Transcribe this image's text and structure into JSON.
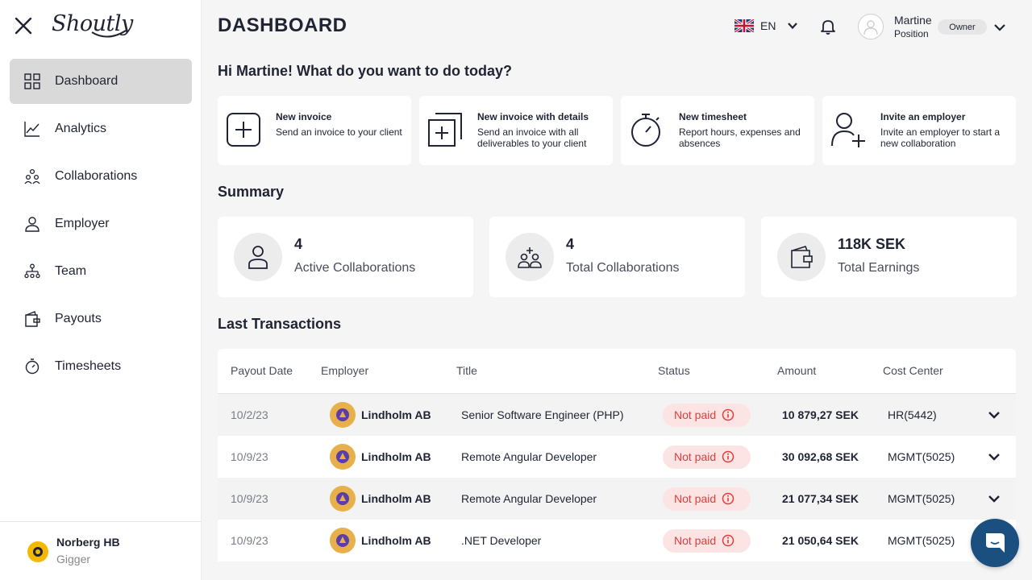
{
  "brand": {
    "logo_text": "Shoutly"
  },
  "sidebar": {
    "items": [
      {
        "label": "Dashboard",
        "icon": "grid-icon",
        "active": true
      },
      {
        "label": "Analytics",
        "icon": "chart-line-icon",
        "active": false
      },
      {
        "label": "Collaborations",
        "icon": "collaborations-icon",
        "active": false
      },
      {
        "label": "Employer",
        "icon": "employer-icon",
        "active": false
      },
      {
        "label": "Team",
        "icon": "team-icon",
        "active": false
      },
      {
        "label": "Payouts",
        "icon": "wallet-icon",
        "active": false
      },
      {
        "label": "Timesheets",
        "icon": "stopwatch-icon",
        "active": false
      }
    ],
    "footer": {
      "company_name": "Norberg HB",
      "company_role": "Gigger"
    }
  },
  "header": {
    "title": "DASHBOARD",
    "language": "EN",
    "user": {
      "name": "Martine",
      "position": "Position",
      "role": "Owner"
    }
  },
  "greeting": "Hi Martine! What do you want to do today?",
  "quick_actions": [
    {
      "title": "New invoice",
      "description": "Send an invoice to your client",
      "icon": "plus-square-icon"
    },
    {
      "title": "New invoice with details",
      "description": "Send an invoice with all deliverables to your client",
      "icon": "plus-document-icon"
    },
    {
      "title": "New timesheet",
      "description": "Report hours, expenses and absences",
      "icon": "stopwatch-icon"
    },
    {
      "title": "Invite an employer",
      "description": "Invite an employer to start a new collaboration",
      "icon": "user-plus-icon"
    }
  ],
  "summary": {
    "title": "Summary",
    "cards": [
      {
        "value": "4",
        "label": "Active Collaborations",
        "icon": "person-icon"
      },
      {
        "value": "4",
        "label": "Total Collaborations",
        "icon": "collaborations-icon"
      },
      {
        "value": "118K SEK",
        "label": "Total Earnings",
        "icon": "wallet-icon"
      }
    ]
  },
  "transactions": {
    "title": "Last Transactions",
    "columns": [
      "Payout Date",
      "Employer",
      "Title",
      "Status",
      "Amount",
      "Cost Center"
    ],
    "rows": [
      {
        "date": "10/2/23",
        "employer": "Lindholm AB",
        "title": "Senior Software Engineer (PHP)",
        "status": "Not paid",
        "amount": "10 879,27 SEK",
        "cost_center": "HR(5442)"
      },
      {
        "date": "10/9/23",
        "employer": "Lindholm AB",
        "title": "Remote Angular Developer",
        "status": "Not paid",
        "amount": "30 092,68 SEK",
        "cost_center": "MGMT(5025)"
      },
      {
        "date": "10/9/23",
        "employer": "Lindholm AB",
        "title": "Remote Angular Developer",
        "status": "Not paid",
        "amount": "21 077,34 SEK",
        "cost_center": "MGMT(5025)"
      },
      {
        "date": "10/9/23",
        "employer": "Lindholm AB",
        "title": ".NET Developer",
        "status": "Not paid",
        "amount": "21 050,64 SEK",
        "cost_center": "MGMT(5025)"
      }
    ]
  },
  "colors": {
    "status_not_paid": "#e23b3b",
    "status_bg": "#fde4e4",
    "chat": "#1b4f80",
    "active_nav": "#d9d9d9"
  }
}
